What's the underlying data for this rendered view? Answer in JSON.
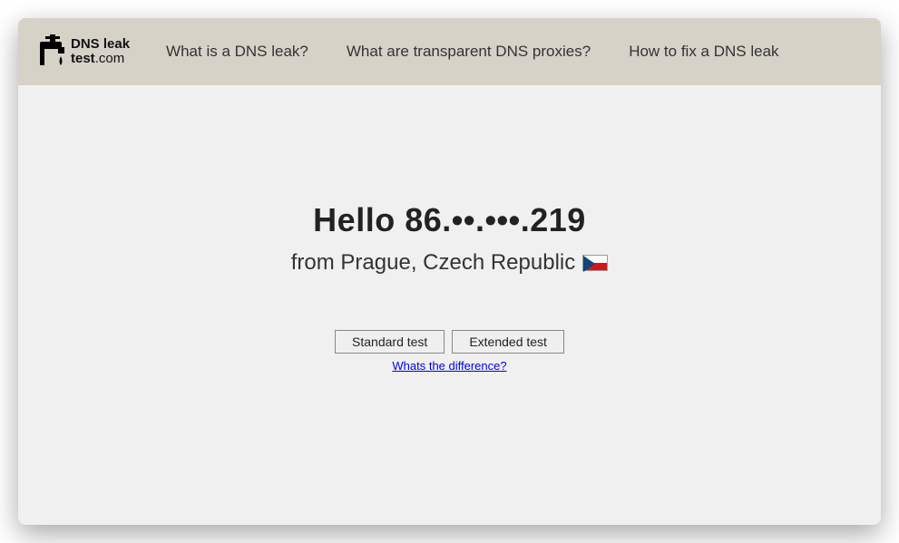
{
  "logo": {
    "line1": "DNS leak",
    "line2_bold": "test",
    "line2_rest": ".com"
  },
  "nav": {
    "items": [
      "What is a DNS leak?",
      "What are transparent DNS proxies?",
      "How to fix a DNS leak"
    ]
  },
  "main": {
    "hello_prefix": "Hello ",
    "ip_display": "86.••.•••.219",
    "from_prefix": "from ",
    "location": "Prague, Czech Republic",
    "country_flag": "Czech Republic"
  },
  "buttons": {
    "standard": "Standard test",
    "extended": "Extended test"
  },
  "diff_link": "Whats the difference?"
}
